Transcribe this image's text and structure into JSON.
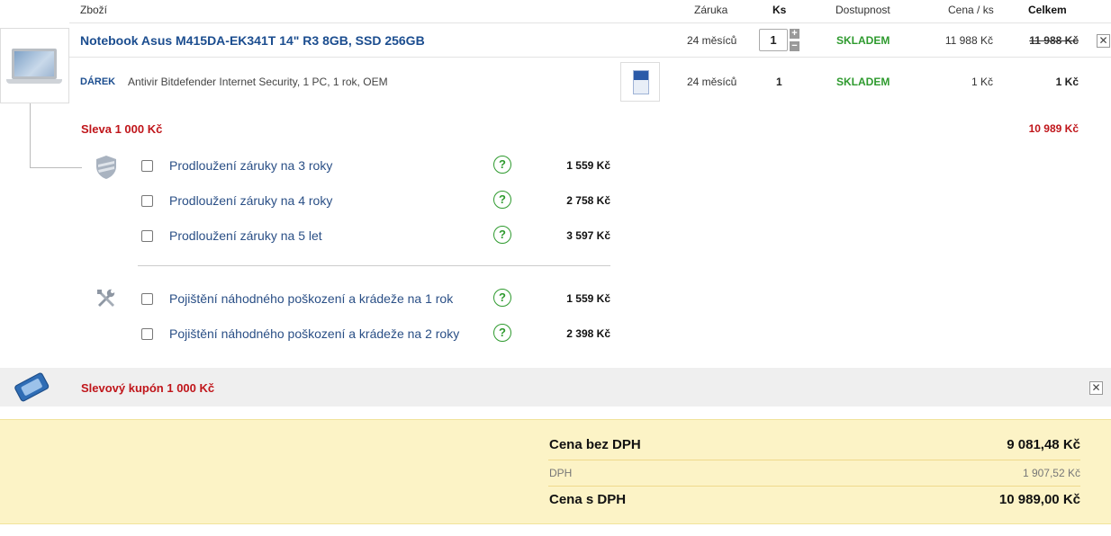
{
  "header": {
    "col_product": "Zboží",
    "col_warranty": "Záruka",
    "col_qty": "Ks",
    "col_availability": "Dostupnost",
    "col_unit_price": "Cena / ks",
    "col_total": "Celkem"
  },
  "product": {
    "title": "Notebook Asus M415DA-EK341T 14\" R3 8GB, SSD 256GB",
    "warranty": "24 měsíců",
    "quantity": "1",
    "availability": "SKLADEM",
    "unit_price": "11 988 Kč",
    "total": "11 988 Kč",
    "remove_label": "✕"
  },
  "gift": {
    "label": "DÁREK",
    "name": "Antivir Bitdefender Internet Security, 1 PC, 1 rok, OEM",
    "warranty": "24 měsíců",
    "quantity": "1",
    "availability": "SKLADEM",
    "unit_price": "1 Kč",
    "total": "1 Kč"
  },
  "discount": {
    "label": "Sleva 1 000 Kč",
    "total_after": "10 989 Kč"
  },
  "warranty_services": [
    {
      "label": "Prodloužení záruky na 3 roky",
      "price": "1 559 Kč"
    },
    {
      "label": "Prodloužení záruky na 4 roky",
      "price": "2 758 Kč"
    },
    {
      "label": "Prodloužení záruky na 5 let",
      "price": "3 597 Kč"
    }
  ],
  "insurance_services": [
    {
      "label": "Pojištění náhodného poškození a krádeže na 1 rok",
      "price": "1 559 Kč"
    },
    {
      "label": "Pojištění náhodného poškození a krádeže na 2 roky",
      "price": "2 398 Kč"
    }
  ],
  "help_glyph": "?",
  "coupon": {
    "label": "Slevový kupón 1 000 Kč",
    "remove_label": "✕"
  },
  "summary": {
    "without_vat_label": "Cena bez DPH",
    "without_vat_value": "9 081,48 Kč",
    "vat_label": "DPH",
    "vat_value": "1 907,52 Kč",
    "with_vat_label": "Cena s DPH",
    "with_vat_value": "10 989,00 Kč"
  },
  "colors": {
    "link_blue": "#1b4d8f",
    "stock_green": "#2e9a2e",
    "discount_red": "#c0161b",
    "summary_bg": "#fcf3c6"
  },
  "icons": {
    "shield": "shield-icon",
    "tools": "tools-icon",
    "coupon": "coupon-icon"
  }
}
